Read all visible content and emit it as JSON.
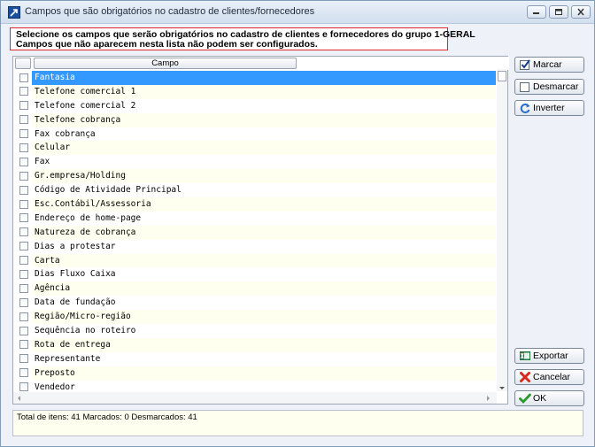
{
  "window": {
    "title": "Campos que são obrigatórios no cadastro de clientes/fornecedores"
  },
  "notice": {
    "line1": "Selecione os campos que serão obrigatórios no cadastro de clientes e fornecedores do grupo   1-GERAL",
    "line2": "Campos que não aparecem nesta lista não podem ser configurados."
  },
  "grid": {
    "column_header": "Campo",
    "rows": [
      {
        "label": "Fantasia",
        "checked": false,
        "selected": true
      },
      {
        "label": "Telefone comercial 1",
        "checked": false
      },
      {
        "label": "Telefone comercial 2",
        "checked": false
      },
      {
        "label": "Telefone cobrança",
        "checked": false
      },
      {
        "label": "Fax cobrança",
        "checked": false
      },
      {
        "label": "Celular",
        "checked": false
      },
      {
        "label": "Fax",
        "checked": false
      },
      {
        "label": "Gr.empresa/Holding",
        "checked": false
      },
      {
        "label": "Código de Atividade Principal",
        "checked": false
      },
      {
        "label": "Esc.Contábil/Assessoria",
        "checked": false
      },
      {
        "label": "Endereço de home-page",
        "checked": false
      },
      {
        "label": "Natureza de cobrança",
        "checked": false
      },
      {
        "label": "Dias a protestar",
        "checked": false
      },
      {
        "label": "Carta",
        "checked": false
      },
      {
        "label": "Dias Fluxo Caixa",
        "checked": false
      },
      {
        "label": "Agência",
        "checked": false
      },
      {
        "label": "Data de fundação",
        "checked": false
      },
      {
        "label": "Região/Micro-região",
        "checked": false
      },
      {
        "label": "Sequência no roteiro",
        "checked": false
      },
      {
        "label": "Rota de entrega",
        "checked": false
      },
      {
        "label": "Representante",
        "checked": false
      },
      {
        "label": "Preposto",
        "checked": false
      },
      {
        "label": "Vendedor",
        "checked": false
      }
    ]
  },
  "buttons": {
    "marcar": "Marcar",
    "desmarcar": "Desmarcar",
    "inverter": "Inverter",
    "exportar": "Exportar",
    "cancelar": "Cancelar",
    "ok": "OK"
  },
  "status": {
    "text": "Total de itens: 41 Marcados: 0 Desmarcados: 41"
  },
  "colors": {
    "selection": "#3399ff",
    "alt_row": "#fffff0",
    "notice_border": "#e0262a"
  }
}
